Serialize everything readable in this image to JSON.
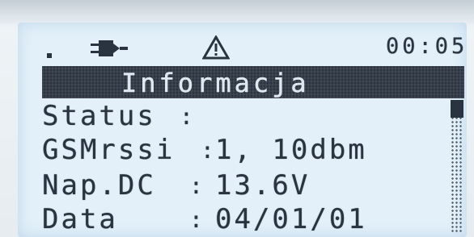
{
  "status_bar": {
    "power_icon": "plug-icon",
    "alert_icon": "warning-icon",
    "time": "00:05"
  },
  "screen": {
    "title": "Informacja",
    "rows": [
      {
        "label": "Status",
        "separator": ":",
        "value": ""
      },
      {
        "label": "GSMrssi",
        "separator": ":",
        "value": "1, 10dbm"
      },
      {
        "label": "Nap.DC",
        "separator": ":",
        "value": "13.6V"
      },
      {
        "label": "Data",
        "separator": ":",
        "value": "04/01/01"
      }
    ]
  }
}
